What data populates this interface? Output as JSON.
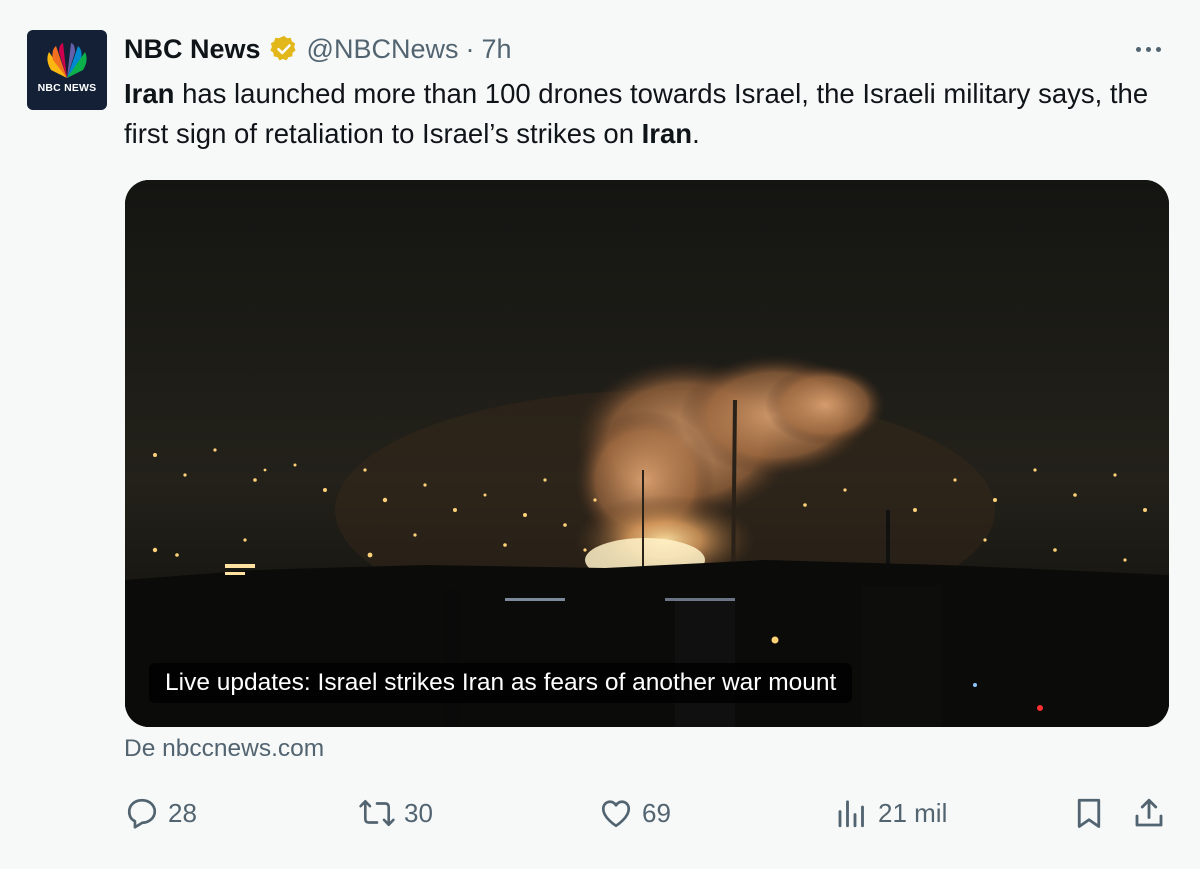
{
  "tweet": {
    "author": {
      "name": "NBC News",
      "handle": "@NBCNews",
      "time": "7h",
      "dot": "·",
      "avatar_text": "NBC NEWS",
      "verified_color": "#e2b719"
    },
    "text": {
      "p1_bold": "Iran",
      "p1_rest": " has launched more than 100 drones towards Israel, the Israeli military says, the first sign of retaliation to Israel’s strikes on ",
      "p2_bold": "Iran",
      "p2_rest": "."
    },
    "card": {
      "caption": "Live updates: Israel strikes Iran as fears of another war mount"
    },
    "source": "De nbccnews.com",
    "actions": {
      "replies": "28",
      "reposts": "30",
      "likes": "69",
      "views": "21 mil"
    }
  }
}
